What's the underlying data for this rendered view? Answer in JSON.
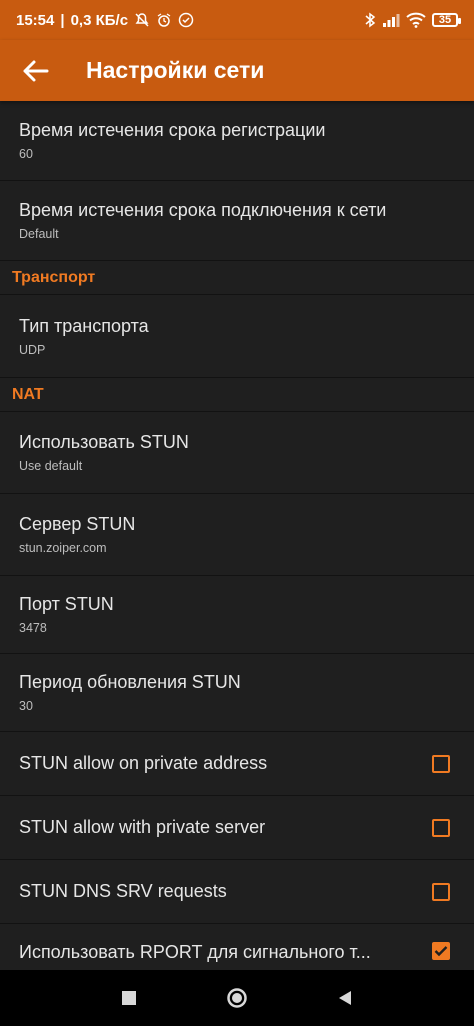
{
  "status_bar": {
    "time": "15:54",
    "speed": "0,3 КБ/с",
    "battery": "35",
    "icons": [
      "mute-icon",
      "alarm-icon",
      "check-circle-icon",
      "bluetooth-icon",
      "signal-icon",
      "wifi-icon",
      "battery-icon"
    ]
  },
  "app_bar": {
    "title": "Настройки сети",
    "back_icon": "arrow-left-icon",
    "color": "#c85b10"
  },
  "accent": "#f07a22",
  "items": {
    "reg_expiry": {
      "title": "Время истечения срока регистрации",
      "summary": "60"
    },
    "conn_expiry": {
      "title": "Время истечения срока подключения к сети",
      "summary": "Default"
    },
    "transport_header": "Транспорт",
    "transport_type": {
      "title": "Тип транспорта",
      "summary": "UDP"
    },
    "nat_header": "NAT",
    "use_stun": {
      "title": "Использовать STUN",
      "summary": "Use default"
    },
    "stun_server": {
      "title": "Сервер STUN",
      "summary": "stun.zoiper.com"
    },
    "stun_port": {
      "title": "Порт STUN",
      "summary": "3478"
    },
    "stun_refresh": {
      "title": "Период обновления STUN",
      "summary": "30"
    },
    "stun_private_addr": {
      "title": "STUN allow on private address",
      "checked": false
    },
    "stun_private_server": {
      "title": "STUN allow with private server",
      "checked": false
    },
    "stun_dns_srv": {
      "title": "STUN DNS SRV requests",
      "checked": false
    },
    "use_rport": {
      "title": "Использовать RPORT для сигнального т...",
      "checked": true
    }
  },
  "nav_bar": {
    "icons": [
      "recents-square-icon",
      "home-circle-icon",
      "back-triangle-icon"
    ]
  }
}
